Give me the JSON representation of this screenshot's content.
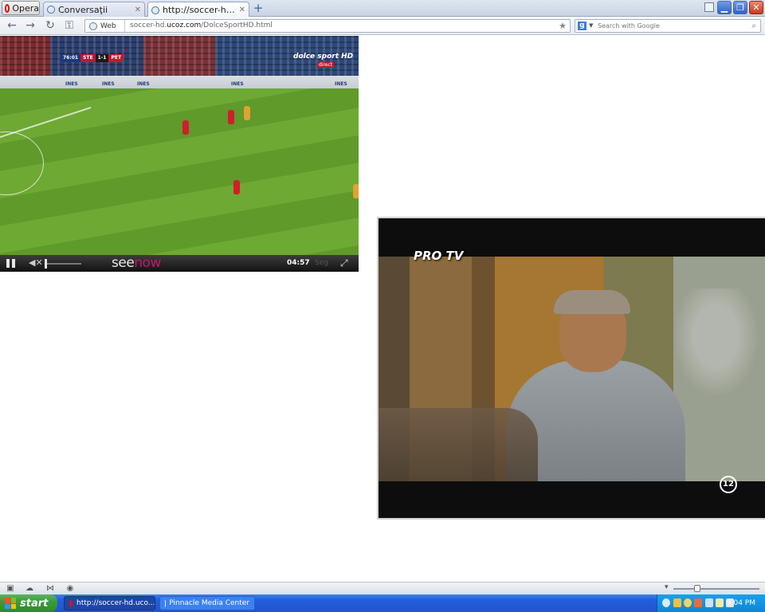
{
  "browser": {
    "menu_label": "Opera",
    "tabs": [
      {
        "title": "Conversaţii",
        "active": false
      },
      {
        "title": "http://soccer-hd.ucoz.co...",
        "active": true
      }
    ],
    "new_tab_icon": "plus-icon",
    "window_buttons": [
      "minimize",
      "restore",
      "close"
    ]
  },
  "address_bar": {
    "badge": "Web",
    "url_prefix": "soccer-hd.",
    "url_domain": "ucoz.com",
    "url_path": "/DolceSportHD.html"
  },
  "search": {
    "engine": "Google",
    "placeholder": "Search with Google"
  },
  "player_left": {
    "scoreboard": {
      "clock": "76:01",
      "home": "STE",
      "score": "1-1",
      "away": "PET"
    },
    "channel_logo": "dolce sport HD",
    "channel_badge": "direct",
    "ad_text": "INES",
    "brand_see": "see",
    "brand_now": "now",
    "time": "04:57",
    "seg": "Seg",
    "state": "playing"
  },
  "player_right": {
    "channel_logo": "PRO TV",
    "rating": "12"
  },
  "taskbar": {
    "start_label": "start",
    "tasks": [
      {
        "label": "http://soccer-hd.uco...",
        "pressed": true
      },
      {
        "label": "Pinnacle Media Center",
        "pressed": false
      }
    ],
    "clock": "9:04 PM"
  },
  "colors": {
    "taskbar_blue": "#245edc",
    "start_green": "#3a9b3a",
    "pitch_green": "#6ea933",
    "seenow_pink": "#c4156a"
  }
}
